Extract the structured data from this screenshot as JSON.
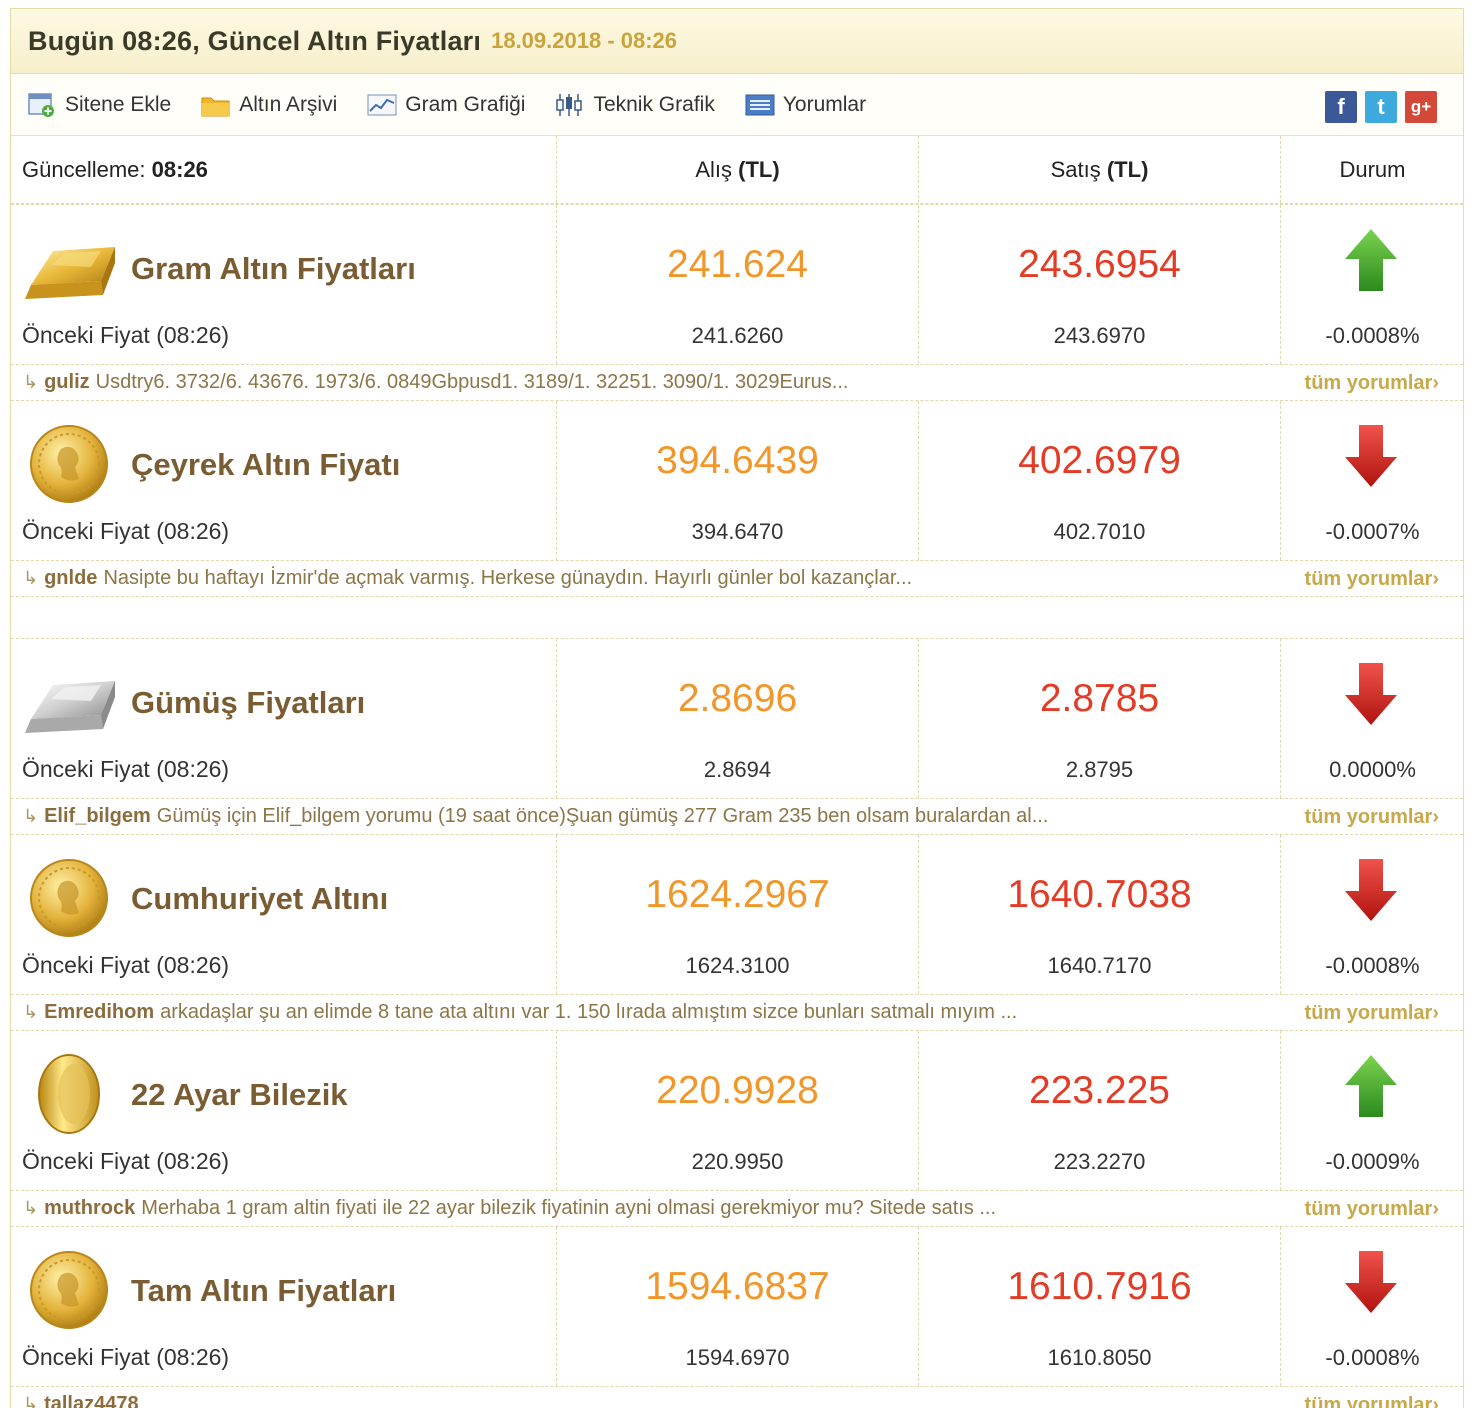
{
  "header": {
    "title": "Bugün 08:26, Güncel Altın Fiyatları",
    "datetime": "18.09.2018 - 08:26"
  },
  "toolbar": {
    "items": [
      {
        "label": "Sitene Ekle",
        "icon": "add-to-site-icon"
      },
      {
        "label": "Altın Arşivi",
        "icon": "folder-icon"
      },
      {
        "label": "Gram Grafiği",
        "icon": "line-chart-icon"
      },
      {
        "label": "Teknik Grafik",
        "icon": "candlestick-icon"
      },
      {
        "label": "Yorumlar",
        "icon": "comments-icon"
      }
    ],
    "social": [
      {
        "label": "f",
        "icon": "facebook-icon",
        "color": "#3b5998"
      },
      {
        "label": "t",
        "icon": "twitter-icon",
        "color": "#3ea9dd"
      },
      {
        "label": "g+",
        "icon": "google-plus-icon",
        "color": "#d34836"
      }
    ]
  },
  "table": {
    "update_label": "Güncelleme:",
    "update_time": "08:26",
    "col_buy": "Alış",
    "col_sell": "Satış",
    "currency": "(TL)",
    "col_status": "Durum",
    "prev_label": "Önceki Fiyat (08:26)",
    "all_comments": "tüm yorumlar›"
  },
  "colors": {
    "buy": "#f0962a",
    "sell": "#e23b26",
    "up": "#3aa12a",
    "down": "#d8261c",
    "name": "#7a5c33"
  },
  "products": [
    {
      "name": "Gram Altın Fiyatları",
      "image": "gold-bar-icon",
      "buy": "241.624",
      "sell": "243.6954",
      "prev_buy": "241.6260",
      "prev_sell": "243.6970",
      "change": "-0.0008%",
      "direction": "up",
      "comment_user": "guliz",
      "comment_text": "Usdtry6. 3732/6. 43676. 1973/6. 0849Gbpusd1. 3189/1. 32251. 3090/1. 3029Eurus..."
    },
    {
      "name": "Çeyrek Altın Fiyatı",
      "image": "gold-coin-icon",
      "buy": "394.6439",
      "sell": "402.6979",
      "prev_buy": "394.6470",
      "prev_sell": "402.7010",
      "change": "-0.0007%",
      "direction": "down",
      "comment_user": "gnlde",
      "comment_text": "Nasipte bu haftayı İzmir'de açmak varmış. Herkese günaydın. Hayırlı günler bol kazançlar..."
    },
    {
      "name": "Gümüş Fiyatları",
      "image": "silver-bar-icon",
      "buy": "2.8696",
      "sell": "2.8785",
      "prev_buy": "2.8694",
      "prev_sell": "2.8795",
      "change": "0.0000%",
      "direction": "down",
      "comment_user": "Elif_bilgem",
      "comment_text": "Gümüş için Elif_bilgem yorumu (19 saat önce)Şuan gümüş 277 Gram 235 ben olsam buralardan al..."
    },
    {
      "name": "Cumhuriyet Altını",
      "image": "gold-coin-icon",
      "buy": "1624.2967",
      "sell": "1640.7038",
      "prev_buy": "1624.3100",
      "prev_sell": "1640.7170",
      "change": "-0.0008%",
      "direction": "down",
      "comment_user": "Emredihom",
      "comment_text": "arkadaşlar şu an elimde 8 tane ata altını var 1. 150 lırada almıştım sizce bunları satmalı mıyım ..."
    },
    {
      "name": "22 Ayar Bilezik",
      "image": "gold-bangle-icon",
      "buy": "220.9928",
      "sell": "223.225",
      "prev_buy": "220.9950",
      "prev_sell": "223.2270",
      "change": "-0.0009%",
      "direction": "up",
      "comment_user": "muthrock",
      "comment_text": "Merhaba 1 gram altin fiyati ile 22 ayar bilezik fiyatinin ayni olmasi gerekmiyor mu? Sitede satıs ..."
    },
    {
      "name": "Tam Altın Fiyatları",
      "image": "gold-coin-icon",
      "buy": "1594.6837",
      "sell": "1610.7916",
      "prev_buy": "1594.6970",
      "prev_sell": "1610.8050",
      "change": "-0.0008%",
      "direction": "down",
      "comment_user": "tallaz4478",
      "comment_text": ""
    }
  ]
}
